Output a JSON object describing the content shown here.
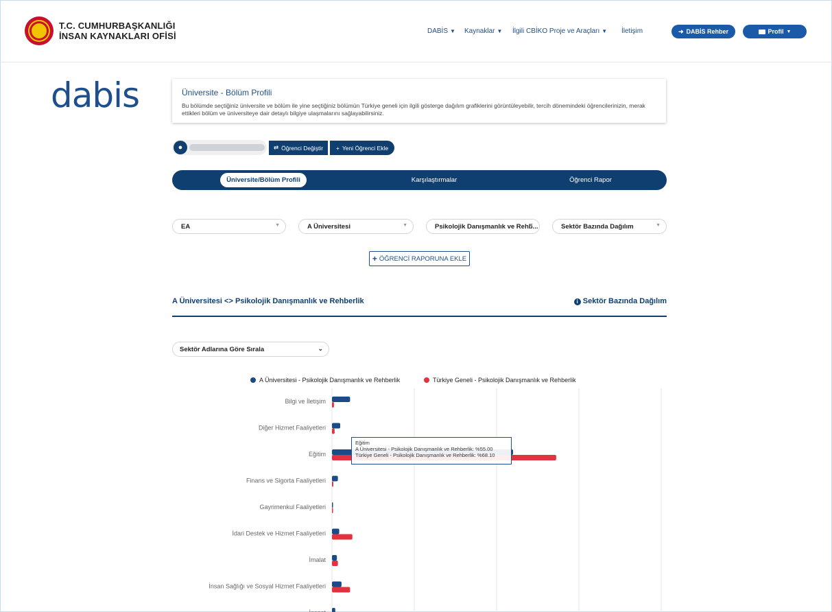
{
  "header": {
    "org_line1": "T.C. CUMHURBAŞKANLIĞI",
    "org_line2": "İNSAN KAYNAKLARI OFİSİ",
    "nav": [
      {
        "label": "DABİS"
      },
      {
        "label": "Kaynaklar"
      },
      {
        "label": "İlgili CBİKO Proje ve Araçları"
      },
      {
        "label": "İletişim"
      }
    ],
    "rehber_button": "DABİS Rehber",
    "profile_button": "Profil"
  },
  "logo_text": "dabis",
  "intro": {
    "title": "Üniversite - Bölüm Profili",
    "description": "Bu bölümde seçtiğiniz üniversite ve bölüm ile yine seçtiğiniz bölümün Türkiye geneli için ilgili gösterge dağılım grafiklerini görüntüleyebilir, tercih dönemindeki öğrencilerinizin, merak ettikleri bölüm ve üniversiteye dair detaylı bilgiye ulaşmalarını sağlayabilirsiniz."
  },
  "student": {
    "change_button": "Öğrenci Değiştir",
    "add_button": "Yeni Öğrenci Ekle"
  },
  "tabs": [
    {
      "label": "Üniversite/Bölüm Profili",
      "active": true
    },
    {
      "label": "Karşılaştırmalar",
      "active": false
    },
    {
      "label": "Öğrenci Rapor",
      "active": false
    }
  ],
  "filters": {
    "score_type": "EA",
    "university": "A Üniversitesi",
    "department": "Psikolojik Danışmanlık ve Rehb...",
    "indicator": "Sektör Bazında Dağılım"
  },
  "add_report_button": "ÖĞRENCİ RAPORUNA EKLE",
  "section": {
    "university": "A Üniversitesi",
    "department": "Psikolojik Danışmanlık ve Rehberlik",
    "indicator": "Sektör Bazında Dağılım"
  },
  "sort_select": "Sektör Adlarına Göre Sırala",
  "colors": {
    "navy": "#0f3f70",
    "series1": "#1a4b86",
    "series2": "#e0333f"
  },
  "chart_data": {
    "type": "bar",
    "orientation": "horizontal",
    "categories": [
      "Bilgi ve İletişim",
      "Diğer Hizmet Faaliyetleri",
      "Eğitim",
      "Finans ve Sigorta Faaliyetleri",
      "Gayrimenkul Faaliyetleri",
      "İdari Destek ve Hizmet Faaliyetleri",
      "İmalat",
      "İnsan Sağlığı ve Sosyal Hizmet Faaliyetleri",
      "İnşaat"
    ],
    "series": [
      {
        "name": "A Üniversitesi - Psikolojik Danışmanlık ve Rehberlik",
        "values": [
          5.5,
          2.5,
          55.0,
          1.8,
          0.0,
          2.2,
          1.5,
          2.9,
          1.0
        ]
      },
      {
        "name": "Türkiye Geneli - Psikolojik Danışmanlık ve Rehberlik",
        "values": [
          0.6,
          0.8,
          68.1,
          0.4,
          0.2,
          6.2,
          1.8,
          5.5,
          1.6
        ]
      }
    ],
    "xlim": [
      0,
      100
    ],
    "grid": true,
    "legend": "top"
  },
  "tooltip": {
    "title": "Eğitim",
    "line1": "A Üniversitesi - Psikolojik Danışmanlık ve Rehberlik: %55.00",
    "line2": "Türkiye Geneli - Psikolojik Danışmanlık ve Rehberlik: %68.10"
  }
}
